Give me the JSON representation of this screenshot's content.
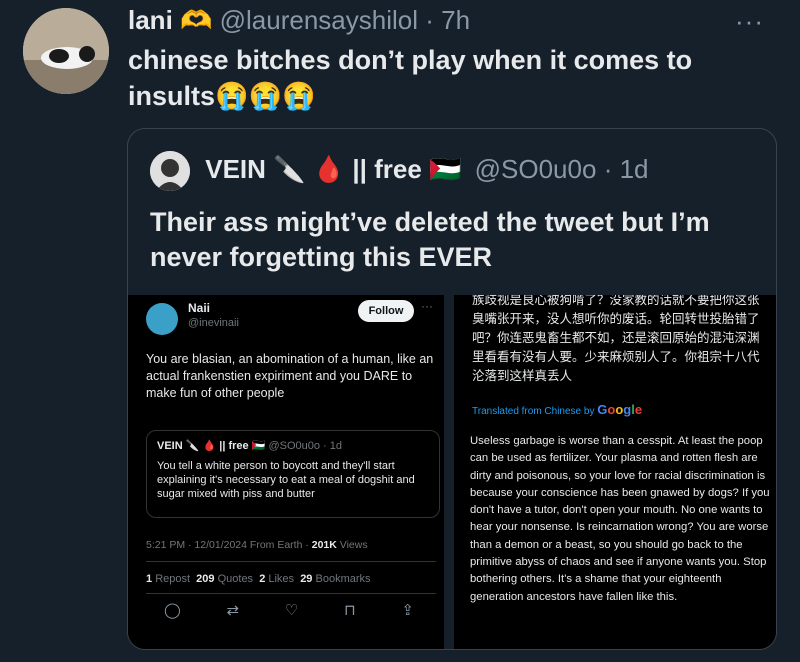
{
  "tweet": {
    "name": "lani",
    "name_emoji": "🫶",
    "handle": "@laurensayshilol",
    "time": "· 7h",
    "more": "···",
    "text": "chinese bitches don’t play when it comes to insults😭😭😭"
  },
  "quoted": {
    "name": "VEIN 🔪 🩸 || free 🇵🇸",
    "handle": "@SO0u0o",
    "time": "· 1d",
    "text": "Their ass might’ve deleted the tweet but I’m never forgetting this EVER"
  },
  "left_screenshot": {
    "name": "Naii",
    "handle": "@inevinaii",
    "follow_label": "Follow",
    "more": "···",
    "text": "You are blasian, an abomination of a human, like an actual frankenstien expiriment and you DARE to make fun of other people",
    "inner_quote": {
      "name": "VEIN 🔪 🩸 || free 🇵🇸",
      "handle": "@SO0u0o · 1d",
      "text": "You tell a white person to boycott and they'll start explaining it's necessary to eat a meal of dogshit and sugar mixed with piss and butter"
    },
    "meta": "5:21 PM · 12/01/2024 From Earth ·",
    "views_count": "201K",
    "views_label": "Views",
    "stats": {
      "reposts_count": "1",
      "reposts_label": "Repost",
      "quotes_count": "209",
      "quotes_label": "Quotes",
      "likes_count": "2",
      "likes_label": "Likes",
      "bookmarks_count": "29",
      "bookmarks_label": "Bookmarks"
    },
    "actions": {
      "reply": "◯",
      "repost": "⇄",
      "like": "♡",
      "bookmark": "⊓",
      "share": "⇪"
    }
  },
  "right_screenshot": {
    "chinese_text": "族歧视是良心被狗啃了？没家教的话就不要把你这张臭嘴张开来，没人想听你的废话。轮回转世投胎错了吧？你连恶鬼畜生都不如，还是滚回原始的混沌深渊里看看有没有人要。少来麻烦别人了。你祖宗十八代沦落到这样真丢人",
    "translated_label": "Translated from Chinese by",
    "google_label": "Google",
    "translation": "Useless garbage is worse than a cesspit. At least the poop can be used as fertilizer. Your plasma and rotten flesh are dirty and poisonous, so your love for racial discrimination is because your conscience has been gnawed by dogs? If you don't have a tutor, don't open your mouth. No one wants to hear your nonsense. Is reincarnation wrong? You are worse than a demon or a beast, so you should go back to the primitive abyss of chaos and see if anyone wants you. Stop bothering others. It's a shame that your eighteenth generation ancestors have fallen like this."
  },
  "colors": {
    "background": "#15202b",
    "accent": "#1d9bf0",
    "muted": "#8b98a5"
  }
}
